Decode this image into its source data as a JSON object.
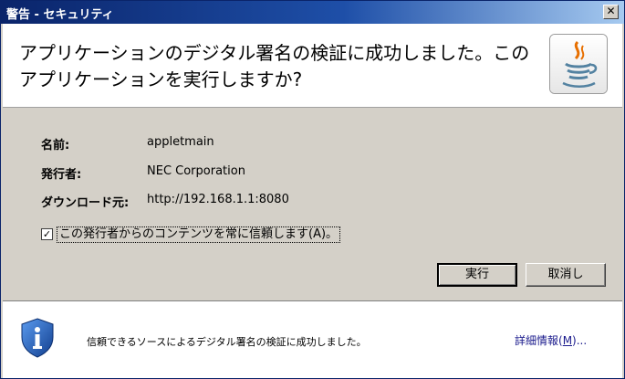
{
  "window": {
    "title": "警告 - セキュリティ",
    "close_symbol": "✕"
  },
  "header": {
    "message": "アプリケーションのデジタル署名の検証に成功しました。このアプリケーションを実行しますか?",
    "icon": "java-icon"
  },
  "details": {
    "name_label": "名前:",
    "name_value": "appletmain",
    "publisher_label": "発行者:",
    "publisher_value": "NEC Corporation",
    "source_label": "ダウンロード元:",
    "source_value": "http://192.168.1.1:8080"
  },
  "checkbox": {
    "checked": true,
    "check_mark": "✓",
    "label": "この発行者からのコンテンツを常に信頼します(A)。"
  },
  "buttons": {
    "run": "実行",
    "cancel": "取消し"
  },
  "footer": {
    "icon": "info-shield-icon",
    "message": "信頼できるソースによるデジタル署名の検証に成功しました。",
    "more_info_prefix": "詳細情報(",
    "more_info_accel": "M",
    "more_info_suffix": ")..."
  },
  "colors": {
    "titlebar_start": "#0a246a",
    "titlebar_end": "#a6caf0",
    "dialog_bg": "#d4d0c8",
    "shield": "#1f5fbf",
    "link": "#1a1a8c"
  }
}
